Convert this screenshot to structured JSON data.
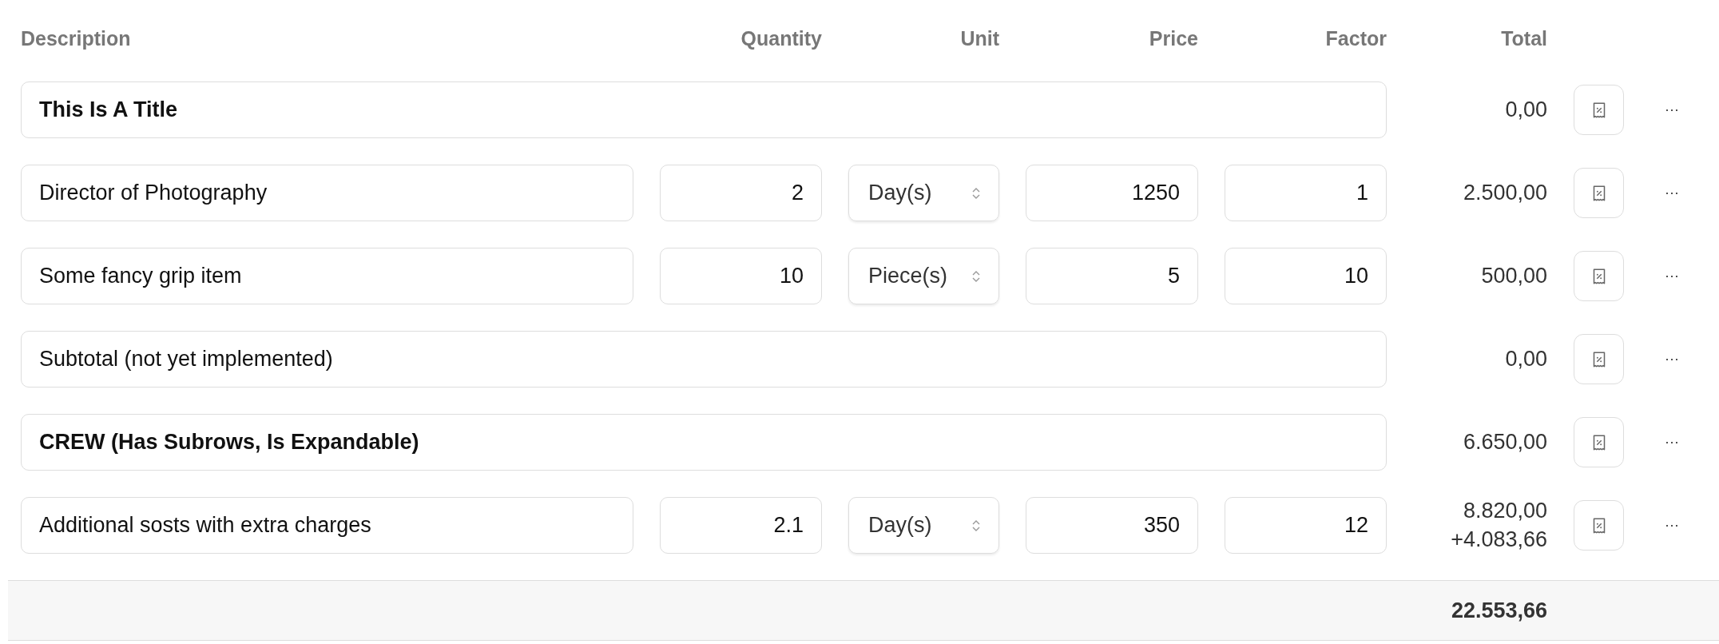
{
  "columns": [
    "Description",
    "Quantity",
    "Unit",
    "Price",
    "Factor",
    "Total"
  ],
  "rows": [
    {
      "kind": "title",
      "description": "This Is A Title",
      "total": "0,00",
      "menu": "···"
    },
    {
      "kind": "item",
      "description": "Director of Photography",
      "quantity": "2",
      "unit": "Day(s)",
      "price": "1250",
      "factor": "1",
      "total": "2.500,00",
      "menu": "···"
    },
    {
      "kind": "item",
      "description": "Some fancy grip item",
      "quantity": "10",
      "unit": "Piece(s)",
      "price": "5",
      "factor": "10",
      "total": "500,00",
      "menu": "···"
    },
    {
      "kind": "subtotal",
      "description": "Subtotal (not yet implemented)",
      "total": "0,00",
      "menu": "···"
    },
    {
      "kind": "group",
      "description": "CREW (Has Subrows, Is Expandable)",
      "total": "6.650,00",
      "menu": "···"
    },
    {
      "kind": "item",
      "description": "Additional sosts with extra charges",
      "quantity": "2.1",
      "unit": "Day(s)",
      "price": "350",
      "factor": "12",
      "total": "8.820,00",
      "extra": "+4.083,66",
      "menu": "···"
    }
  ],
  "grand_total": "22.553,66"
}
